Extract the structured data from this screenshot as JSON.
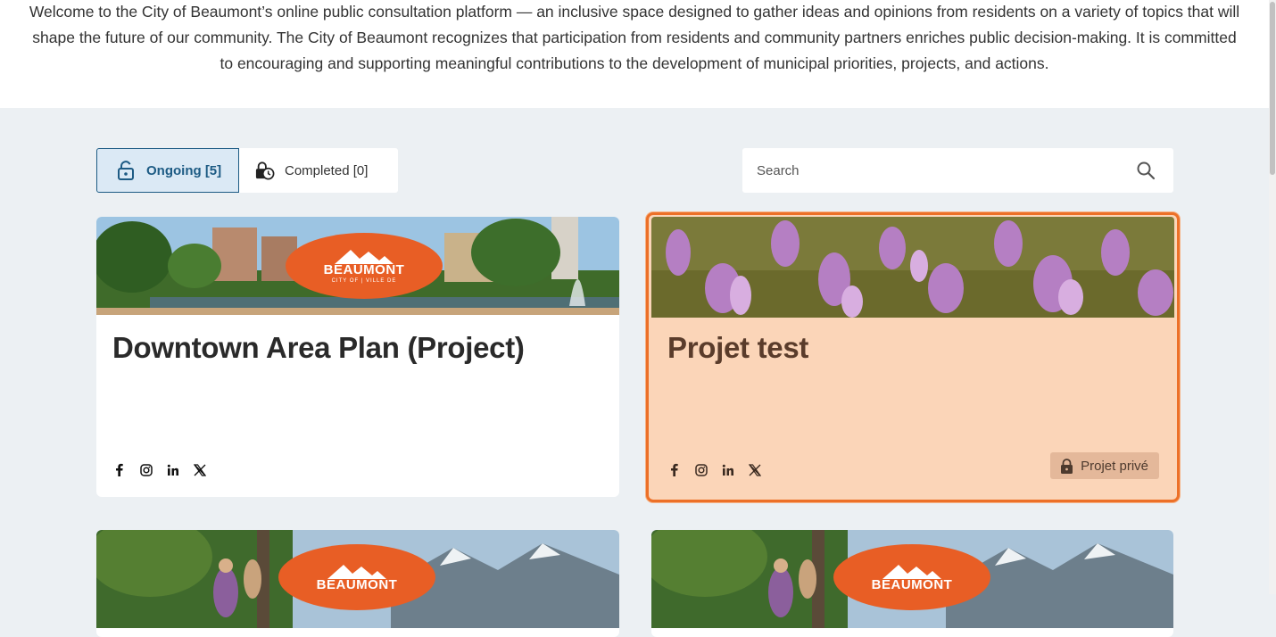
{
  "intro": {
    "text": "Welcome to the City of Beaumont’s online public consultation platform — an inclusive space designed to gather ideas and opinions from residents on a variety of topics that will shape the future of our community. The City of Beaumont recognizes that participation from residents and community partners enriches public decision-making. It is committed to encouraging and supporting meaningful contributions to the development of municipal priorities, projects, and actions."
  },
  "tabs": [
    {
      "label": "Ongoing [5]",
      "icon": "lock-open-icon",
      "active": true
    },
    {
      "label": "Completed [0]",
      "icon": "clock-lock-icon",
      "active": false
    }
  ],
  "search": {
    "placeholder": "Search",
    "value": ""
  },
  "cards": [
    {
      "title": "Downtown Area Plan (Project)",
      "banner": "beaumont-downtown-park",
      "logo_word": "BEAUMONT",
      "logo_sub": "CITY OF | VILLE DE",
      "badge": null
    },
    {
      "title": "Projet test",
      "banner": "purple-crocus-flowers",
      "badge": "Projet privé",
      "highlighted": true
    },
    {
      "title": "",
      "banner": "hikers-mountain-trail",
      "logo_word": "BEAUMONT"
    },
    {
      "title": "",
      "banner": "hikers-mountain-trail",
      "logo_word": "BEAUMONT"
    }
  ],
  "social_icons": [
    "facebook-icon",
    "instagram-icon",
    "linkedin-icon",
    "x-icon"
  ],
  "colors": {
    "accent_blue": "#1d5b84",
    "highlight_border": "#ec7028",
    "highlight_bg": "#fbd5b8",
    "logo_orange": "#e85e25",
    "page_bg": "#ecf0f3"
  }
}
